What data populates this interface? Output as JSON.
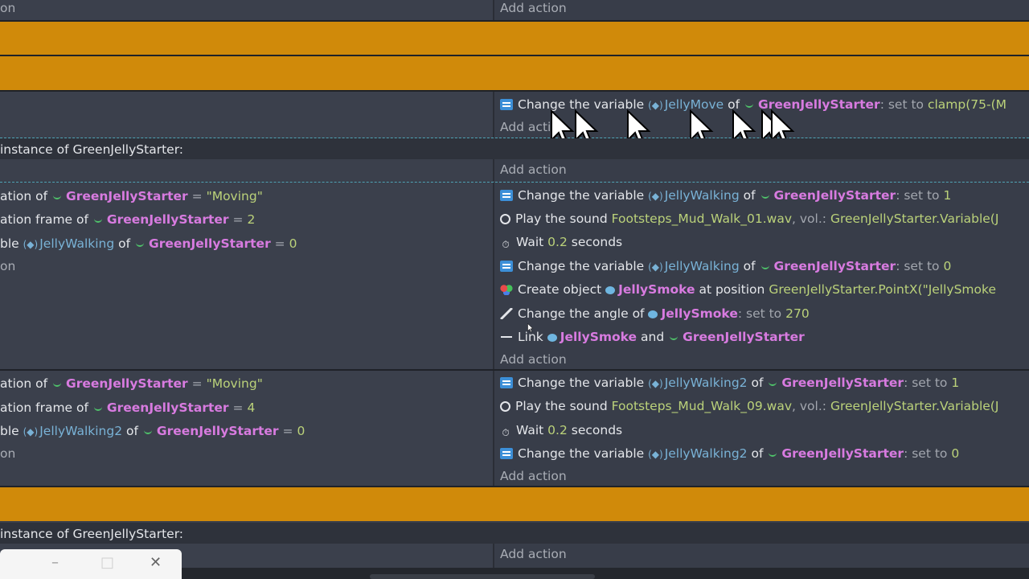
{
  "top": {
    "partial_condition_tail": "on",
    "add_action": "Add action"
  },
  "event1": {
    "action": {
      "prefix": "Change the variable",
      "variable": "JellyMove",
      "of": "of",
      "object": "GreenJellyStarter",
      "set_to": ": set to",
      "value": "clamp(75-(M"
    },
    "add_action": "Add action"
  },
  "subheader1": {
    "text": "instance of GreenJellyStarter:",
    "add_action": "Add action"
  },
  "event2": {
    "conditions": {
      "c1": {
        "prefix": "ation of",
        "object": "GreenJellyStarter",
        "op": "=",
        "value": "\"Moving\""
      },
      "c2": {
        "prefix": "ation frame of",
        "object": "GreenJellyStarter",
        "op": "=",
        "value": "2"
      },
      "c3": {
        "prefix": "ble",
        "variable": "JellyWalking",
        "of": "of",
        "object": "GreenJellyStarter",
        "op": "=",
        "value": "0"
      },
      "c4": {
        "text": "on"
      }
    },
    "actions": {
      "a1": {
        "prefix": "Change the variable",
        "variable": "JellyWalking",
        "of": "of",
        "object": "GreenJellyStarter",
        "set_to": ": set to",
        "value": "1"
      },
      "a2": {
        "prefix": "Play the sound",
        "file": "Footsteps_Mud_Walk_01.wav",
        "sep": ", vol.:",
        "value": "GreenJellyStarter.Variable(J"
      },
      "a3": {
        "prefix": "Wait",
        "value": "0.2",
        "suffix": "seconds"
      },
      "a4": {
        "prefix": "Change the variable",
        "variable": "JellyWalking",
        "of": "of",
        "object": "GreenJellyStarter",
        "set_to": ": set to",
        "value": "0"
      },
      "a5": {
        "prefix": "Create object",
        "object": "JellySmoke",
        "mid": "at position",
        "value": "GreenJellyStarter.PointX(\"JellySmoke"
      },
      "a6": {
        "prefix": "Change the angle of",
        "object": "JellySmoke",
        "set_to": ": set to",
        "value": "270"
      },
      "a7": {
        "prefix": "Link",
        "object": "JellySmoke",
        "mid": "and",
        "object2": "GreenJellyStarter"
      }
    },
    "add_action": "Add action"
  },
  "event3": {
    "conditions": {
      "c1": {
        "prefix": "ation of",
        "object": "GreenJellyStarter",
        "op": "=",
        "value": "\"Moving\""
      },
      "c2": {
        "prefix": "ation frame of",
        "object": "GreenJellyStarter",
        "op": "=",
        "value": "4"
      },
      "c3": {
        "prefix": "ble",
        "variable": "JellyWalking2",
        "of": "of",
        "object": "GreenJellyStarter",
        "op": "=",
        "value": "0"
      },
      "c4": {
        "text": "on"
      }
    },
    "actions": {
      "a1": {
        "prefix": "Change the variable",
        "variable": "JellyWalking2",
        "of": "of",
        "object": "GreenJellyStarter",
        "set_to": ": set to",
        "value": "1"
      },
      "a2": {
        "prefix": "Play the sound",
        "file": "Footsteps_Mud_Walk_09.wav",
        "sep": ", vol.:",
        "value": "GreenJellyStarter.Variable(J"
      },
      "a3": {
        "prefix": "Wait",
        "value": "0.2",
        "suffix": "seconds"
      },
      "a4": {
        "prefix": "Change the variable",
        "variable": "JellyWalking2",
        "of": "of",
        "object": "GreenJellyStarter",
        "set_to": ": set to",
        "value": "0"
      }
    },
    "add_action": "Add action"
  },
  "subheader2": {
    "text": "instance of GreenJellyStarter:",
    "add_action": "Add action"
  },
  "window_controls": {
    "minimize": "–",
    "maximize": "□",
    "close": "✕"
  },
  "colors": {
    "accent_orange": "#d08a0a",
    "object_pink": "#d87be0",
    "variable_blue": "#79b2d6",
    "value_green": "#bbd27a",
    "background": "#393e4a"
  }
}
